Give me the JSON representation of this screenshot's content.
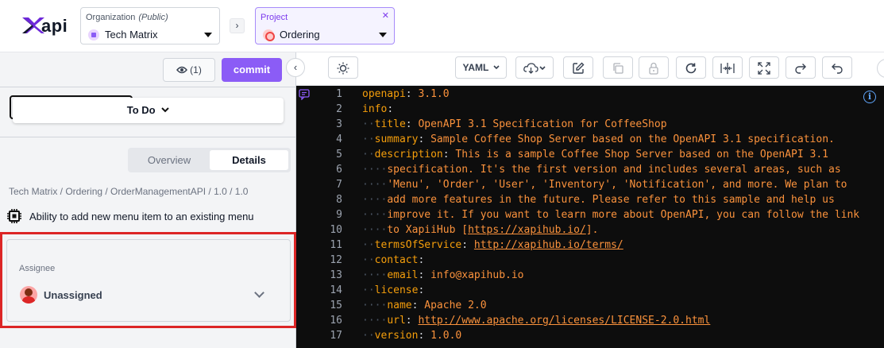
{
  "header": {
    "logo_text": "api",
    "org": {
      "label": "Organization",
      "tag": "(Public)",
      "value": "Tech Matrix"
    },
    "project": {
      "label": "Project",
      "value": "Ordering",
      "close": "✕"
    },
    "nav_chevron": "›"
  },
  "left": {
    "views_label": "(1)",
    "commit_label": "commit",
    "collapse_glyph": "‹",
    "status_label": "To Do",
    "tabs": [
      {
        "label": "Overview"
      },
      {
        "label": "Details"
      }
    ],
    "breadcrumb": "Tech Matrix / Ordering / OrderManagementAPI / 1.0 / 1.0",
    "item_title": "Ability to add new menu item to an existing menu",
    "assignee": {
      "label": "Assignee",
      "value": "Unassigned"
    }
  },
  "toolbar": {
    "format_label": "YAML",
    "icons": [
      "sun-icon",
      "format-dropdown",
      "cloud-download-icon",
      "edit-icon",
      "copy-icon",
      "lock-icon",
      "refresh-icon",
      "split-icon",
      "expand-icon",
      "redo-icon",
      "undo-icon"
    ]
  },
  "editor": {
    "line_numbers": [
      "1",
      "2",
      "3",
      "4",
      "5",
      "6",
      "7",
      "8",
      "9",
      "10",
      "11",
      "12",
      "13",
      "14",
      "15",
      "16",
      "17"
    ],
    "lines": [
      [
        "openapi",
        ": ",
        "3.1.0"
      ],
      [
        "info",
        ":",
        ""
      ],
      [
        "title",
        ": ",
        "OpenAPI 3.1 Specification for CoffeeShop"
      ],
      [
        "summary",
        ": ",
        "Sample Coffee Shop Server based on the OpenAPI 3.1 specification."
      ],
      [
        "description",
        ": ",
        "This is a sample Coffee Shop Server based on the OpenAPI 3.1"
      ],
      [
        "",
        "",
        "specification. It's the first version and includes several areas, such as"
      ],
      [
        "",
        "",
        "'Menu', 'Order', 'User', 'Inventory', 'Notification', and more. We plan to"
      ],
      [
        "",
        "",
        "add more features in the future. Please refer to this sample and help us"
      ],
      [
        "",
        "",
        "improve it. If you want to learn more about OpenAPI, you can follow the link"
      ],
      [
        "",
        "",
        "to XapiiHub [https://xapihub.io/]."
      ],
      [
        "termsOfService",
        ": ",
        "http://xapihub.io/terms/"
      ],
      [
        "contact",
        ":",
        ""
      ],
      [
        "email",
        ": ",
        "info@xapihub.io"
      ],
      [
        "license",
        ":",
        ""
      ],
      [
        "name",
        ": ",
        "Apache 2.0"
      ],
      [
        "url",
        ": ",
        "http://www.apache.org/licenses/LICENSE-2.0.html"
      ],
      [
        "version",
        ": ",
        "1.0.0"
      ]
    ]
  },
  "colors": {
    "accent": "#8b5cf6",
    "highlight_border": "#dc2626",
    "editor_bg": "#0d0d0d"
  }
}
